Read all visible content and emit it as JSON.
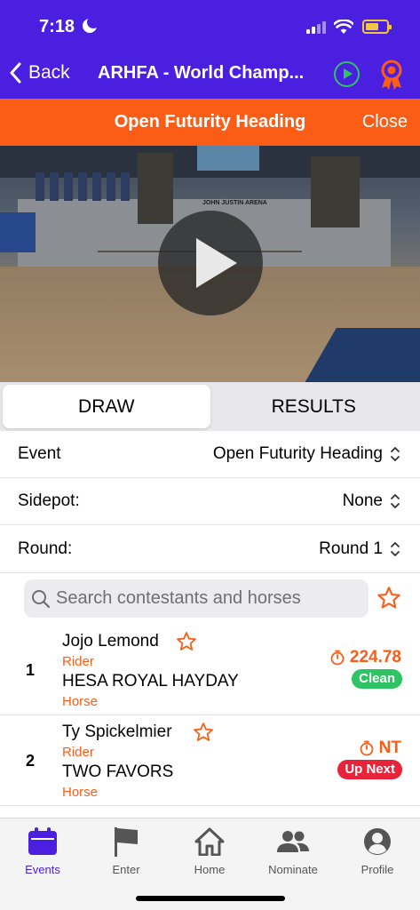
{
  "status": {
    "time": "7:18"
  },
  "nav": {
    "back_label": "Back",
    "title": "ARHFA - World Champ..."
  },
  "banner": {
    "title": "Open Futurity Heading",
    "close_label": "Close"
  },
  "video": {
    "arena_text": "JOHN JUSTIN ARENA"
  },
  "tabs": [
    {
      "label": "DRAW"
    },
    {
      "label": "RESULTS"
    }
  ],
  "filters": {
    "event": {
      "label": "Event",
      "value": "Open Futurity Heading"
    },
    "sidepot": {
      "label": "Sidepot:",
      "value": "None"
    },
    "round": {
      "label": "Round:",
      "value": "Round 1"
    }
  },
  "search": {
    "placeholder": "Search contestants and horses"
  },
  "contestants": [
    {
      "number": "1",
      "rider": "Jojo Lemond",
      "rider_label": "Rider",
      "horse": "HESA ROYAL HAYDAY",
      "horse_label": "Horse",
      "time": "224.78",
      "status": "Clean",
      "status_color": "#2ec463"
    },
    {
      "number": "2",
      "rider": "Ty Spickelmier",
      "rider_label": "Rider",
      "horse": "TWO FAVORS",
      "horse_label": "Horse",
      "time": "NT",
      "status": "Up Next",
      "status_color": "#e8243b"
    }
  ],
  "tabbar": [
    {
      "label": "Events",
      "icon": "calendar-icon"
    },
    {
      "label": "Enter",
      "icon": "flag-icon"
    },
    {
      "label": "Home",
      "icon": "home-icon"
    },
    {
      "label": "Nominate",
      "icon": "people-icon"
    },
    {
      "label": "Profile",
      "icon": "profile-icon"
    }
  ],
  "colors": {
    "primary": "#4b1fe0",
    "accent": "#fb5d16",
    "clean": "#2ec463",
    "up_next": "#e8243b"
  }
}
